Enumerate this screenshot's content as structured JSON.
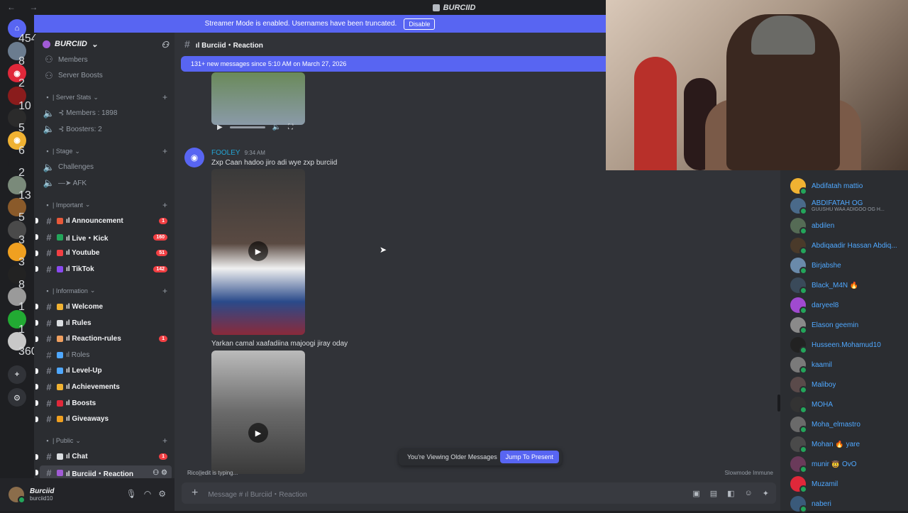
{
  "window": {
    "title": "BURCIID",
    "nav": "←  →"
  },
  "banner": {
    "text": "Streamer Mode is enabled. Usernames have been truncated.",
    "button": "Disable"
  },
  "servers": [
    {
      "label": "⌂",
      "badge": "454",
      "color": "#5865f2"
    },
    {
      "label": "",
      "badge": "8",
      "color": "#6b7c8f"
    },
    {
      "label": "◉",
      "badge": "2",
      "color": "#e0283a"
    },
    {
      "label": "",
      "badge": "10",
      "color": "#8a1c1c"
    },
    {
      "label": "",
      "badge": "5",
      "color": "#2b2b2b"
    },
    {
      "label": "◉",
      "badge": "6",
      "color": "#f0b232"
    },
    {
      "label": "",
      "badge": "2",
      "color": "#1e1f22"
    },
    {
      "label": "",
      "badge": "13",
      "color": "#7a8a7a"
    },
    {
      "label": "",
      "badge": "5",
      "color": "#8a5a2a"
    },
    {
      "label": "",
      "badge": "3",
      "color": "#4a4a4a"
    },
    {
      "label": "",
      "badge": "3",
      "color": "#f0a020"
    },
    {
      "label": "",
      "badge": "8",
      "color": "#222"
    },
    {
      "label": "",
      "badge": "1",
      "color": "#9a9a9a"
    },
    {
      "label": "",
      "badge": "1",
      "color": "#22aa33"
    },
    {
      "label": "",
      "badge": "360",
      "color": "#c8c8c8"
    }
  ],
  "guild": {
    "name": "BURCIID"
  },
  "channels": [
    {
      "kind": "item",
      "icon": "",
      "label": "Members"
    },
    {
      "kind": "item",
      "icon": "",
      "label": "Server Boosts"
    },
    {
      "kind": "cat",
      "label": "| Server Stats"
    },
    {
      "kind": "voice",
      "label": "⊰ Members : 1898"
    },
    {
      "kind": "voice",
      "label": "⊰ Boosters: 2"
    },
    {
      "kind": "cat",
      "label": "| Stage"
    },
    {
      "kind": "voice",
      "label": "Challenges"
    },
    {
      "kind": "voice",
      "label": "—➤ AFK"
    },
    {
      "kind": "cat",
      "label": "| Important"
    },
    {
      "kind": "text",
      "label": "ıl Announcement",
      "unread": true,
      "count": "1",
      "em": "#e8593a"
    },
    {
      "kind": "text",
      "label": "ıl Live・Kick",
      "unread": true,
      "count": "160",
      "em": "#23a55a"
    },
    {
      "kind": "text",
      "label": "ıl Youtube",
      "unread": true,
      "count": "51",
      "em": "#f23f43"
    },
    {
      "kind": "text",
      "label": "ıl TikTok",
      "unread": true,
      "count": "142",
      "em": "#8a4af0"
    },
    {
      "kind": "cat",
      "label": "| Information"
    },
    {
      "kind": "text",
      "label": "ıl Welcome",
      "unread": true,
      "em": "#f0b232"
    },
    {
      "kind": "text",
      "label": "ıl Rules",
      "unread": true,
      "em": "#dbdee1"
    },
    {
      "kind": "text",
      "label": "ıl Reaction-rules",
      "unread": true,
      "count": "1",
      "em": "#f0a060"
    },
    {
      "kind": "text",
      "label": "ıl Roles",
      "unread": false,
      "em": "#4fa8ff"
    },
    {
      "kind": "text",
      "label": "ıl Level-Up",
      "unread": true,
      "em": "#4fa8ff"
    },
    {
      "kind": "text",
      "label": "ıl Achievements",
      "unread": true,
      "em": "#f0b232"
    },
    {
      "kind": "text",
      "label": "ıl Boosts",
      "unread": true,
      "em": "#e0283a"
    },
    {
      "kind": "text",
      "label": "ıl Giveaways",
      "unread": true,
      "em": "#f0a020"
    },
    {
      "kind": "cat",
      "label": "| Public"
    },
    {
      "kind": "text",
      "label": "ıl Chat",
      "unread": true,
      "count": "1",
      "em": "#dbdee1"
    },
    {
      "kind": "text",
      "label": "ıl Burciid・Reaction",
      "unread": true,
      "selected": true,
      "em": "#a15bd6"
    }
  ],
  "user": {
    "name": "Burciid",
    "tag": "burciid10"
  },
  "chat": {
    "channel_title": "ıl Burciid・Reaction",
    "new_messages": "131+ new messages since 5:10 AM on March 27, 2026",
    "message": {
      "author": "FOOLEY",
      "time": "9:34 AM",
      "text": "Zxp Caan hadoo jiro adi wye zxp burciid"
    },
    "second_text": "Yarkan camal xaafadiina majoogi jiray oday",
    "older_notice": "You're Viewing Older Messages",
    "jump_button": "Jump To Present",
    "typing": "Rico||edit is typing...",
    "slowmode": "Slowmode Immune",
    "composer_placeholder": "Message # ıl Burciid・Reaction"
  },
  "members": [
    {
      "name": "Abdifatah mattio",
      "color": "#f0b232"
    },
    {
      "name": "ABDIFATAH OG",
      "sub": "GUUSHU WAA ADIGOO OG H...",
      "color": "#4a6a8a"
    },
    {
      "name": "abdilen",
      "color": "#556b55"
    },
    {
      "name": "Abdiqaadir Hassan Abdiq...",
      "color": "#4a3a2a"
    },
    {
      "name": "Birjabshe",
      "color": "#6a8aaa"
    },
    {
      "name": "Black_M4N 🔥",
      "color": "#3a4a5a"
    },
    {
      "name": "daryeel8",
      "color": "#a04ad0"
    },
    {
      "name": "Elason geemin",
      "color": "#8a8a8a"
    },
    {
      "name": "Husseen.Mohamud10",
      "color": "#222"
    },
    {
      "name": "kaamil",
      "color": "#7a7a7a"
    },
    {
      "name": "Maliboy",
      "color": "#5a4a4a"
    },
    {
      "name": "MOHA",
      "color": "#333"
    },
    {
      "name": "Moha_elmastro",
      "color": "#6a6a6a"
    },
    {
      "name": "Mohan 🔥 yare",
      "color": "#4a4a4a"
    },
    {
      "name": "munir 🤠 OvO",
      "color": "#6a3a5a"
    },
    {
      "name": "Muzamil",
      "color": "#e0283a"
    },
    {
      "name": "naberi",
      "color": "#3a5a7a"
    }
  ]
}
